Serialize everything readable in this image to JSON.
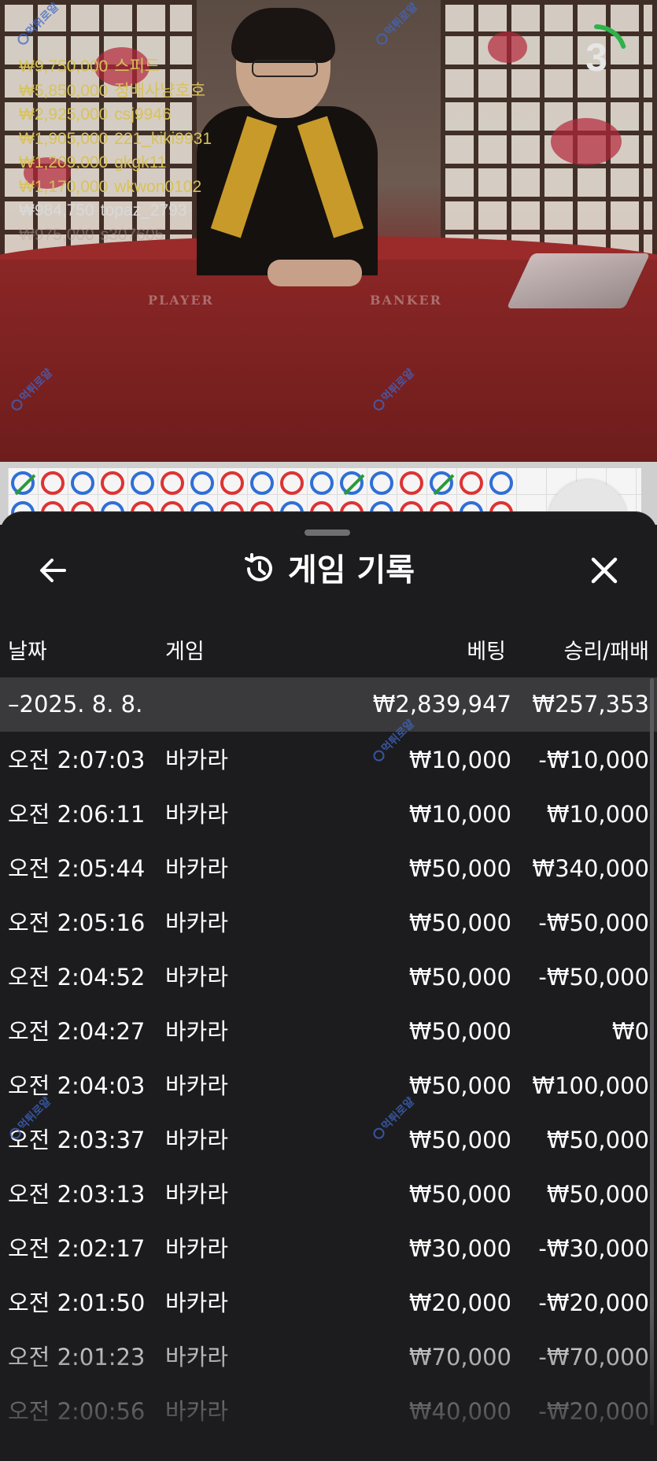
{
  "leaderboard": [
    {
      "amount": "₩9,750,000",
      "user": "스피드",
      "color": "#d8c25a"
    },
    {
      "amount": "₩5,850,000",
      "user": "정배사냥호호",
      "color": "#d8c25a"
    },
    {
      "amount": "₩2,925,000",
      "user": "csj9946",
      "color": "#d8c25a"
    },
    {
      "amount": "₩1,905,000",
      "user": "221_kiki9931",
      "color": "#d8c25a"
    },
    {
      "amount": "₩1,209,000",
      "user": "gkgk11",
      "color": "#d8c25a"
    },
    {
      "amount": "₩1,170,000",
      "user": "wkwon0102",
      "color": "#d8c25a"
    },
    {
      "amount": "₩984,750",
      "user": "topaz_2793",
      "color": "#d9d9d9"
    },
    {
      "amount": "₩975,000",
      "user": "s307605",
      "color": "#b5a9a2"
    }
  ],
  "timer": {
    "value": "3",
    "progress": 0.2,
    "color": "#2fb24a"
  },
  "table_labels": {
    "player": "PLAYER",
    "banker": "BANKER"
  },
  "watermark": "먹튀로얄",
  "road": {
    "top_row": [
      "T",
      "B",
      "P",
      "B",
      "P",
      "B",
      "P",
      "B",
      "P",
      "B",
      "P",
      "T",
      "P",
      "B",
      "T",
      "B",
      "P"
    ],
    "colors": {
      "B": "#d33333",
      "P": "#2f6fd6",
      "T": "#2a9a3a"
    }
  },
  "panel": {
    "title": "게임 기록",
    "back_icon": "arrow-left-icon",
    "history_icon": "history-icon",
    "close_icon": "close-icon",
    "columns": {
      "date": "날짜",
      "game": "게임",
      "bet": "베팅",
      "result": "승리/패배"
    },
    "date_group": {
      "date": "–2025. 8. 8.",
      "bet_total": "₩2,839,947",
      "result_total": "₩257,353"
    },
    "rows": [
      {
        "time": "오전 2:07:03",
        "game": "바카라",
        "bet": "₩10,000",
        "result": "-₩10,000"
      },
      {
        "time": "오전 2:06:11",
        "game": "바카라",
        "bet": "₩10,000",
        "result": "₩10,000"
      },
      {
        "time": "오전 2:05:44",
        "game": "바카라",
        "bet": "₩50,000",
        "result": "₩340,000"
      },
      {
        "time": "오전 2:05:16",
        "game": "바카라",
        "bet": "₩50,000",
        "result": "-₩50,000"
      },
      {
        "time": "오전 2:04:52",
        "game": "바카라",
        "bet": "₩50,000",
        "result": "-₩50,000"
      },
      {
        "time": "오전 2:04:27",
        "game": "바카라",
        "bet": "₩50,000",
        "result": "₩0"
      },
      {
        "time": "오전 2:04:03",
        "game": "바카라",
        "bet": "₩50,000",
        "result": "₩100,000"
      },
      {
        "time": "오전 2:03:37",
        "game": "바카라",
        "bet": "₩50,000",
        "result": "₩50,000"
      },
      {
        "time": "오전 2:03:13",
        "game": "바카라",
        "bet": "₩50,000",
        "result": "₩50,000"
      },
      {
        "time": "오전 2:02:17",
        "game": "바카라",
        "bet": "₩30,000",
        "result": "-₩30,000"
      },
      {
        "time": "오전 2:01:50",
        "game": "바카라",
        "bet": "₩20,000",
        "result": "-₩20,000"
      },
      {
        "time": "오전 2:01:23",
        "game": "바카라",
        "bet": "₩70,000",
        "result": "-₩70,000"
      },
      {
        "time": "오전 2:00:56",
        "game": "바카라",
        "bet": "₩40,000",
        "result": "-₩20,000"
      }
    ]
  }
}
